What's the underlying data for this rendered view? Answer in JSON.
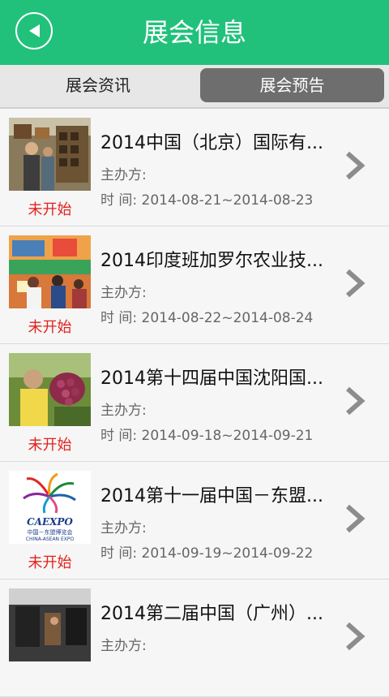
{
  "header": {
    "title": "展会信息",
    "back_icon": "back-arrow-icon"
  },
  "tabs": [
    {
      "label": "展会资讯",
      "active": false
    },
    {
      "label": "展会预告",
      "active": true
    }
  ],
  "list": {
    "items": [
      {
        "name": "2014中国（北京）国际有...",
        "status": "未开始",
        "organizer": "主办方:",
        "time": "时    间:  2014-08-21~2014-08-23"
      },
      {
        "name": "2014印度班加罗尔农业技...",
        "status": "未开始",
        "organizer": "主办方:",
        "time": "时    间:  2014-08-22~2014-08-24"
      },
      {
        "name": "2014第十四届中国沈阳国...",
        "status": "未开始",
        "organizer": "主办方:",
        "time": "时    间:  2014-09-18~2014-09-21"
      },
      {
        "name": "2014第十一届中国－东盟...",
        "status": "未开始",
        "organizer": "主办方:",
        "time": "时    间:  2014-09-19~2014-09-22"
      },
      {
        "name": "2014第二届中国（广州）...",
        "status": "",
        "organizer": "主办方:",
        "time": ""
      }
    ]
  },
  "logo_text": {
    "main": "CAEXPO",
    "cn": "中国－东盟博览会",
    "en": "CHINA-ASEAN EXPO"
  },
  "colors": {
    "header": "#21c17c",
    "status": "#e3211d",
    "active_tab": "#6e6e6e"
  }
}
